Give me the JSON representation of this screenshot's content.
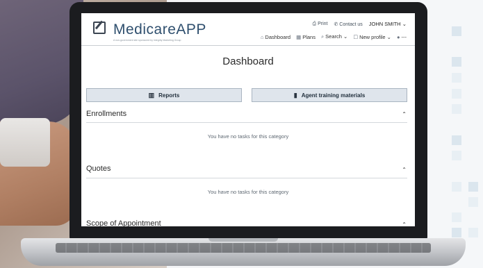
{
  "app": {
    "logo_text": "MedicareAPP",
    "tagline": "A non-government site sponsored by Integrity Marketing Group"
  },
  "header": {
    "utility": {
      "print_label": "Print",
      "contact_label": "Contact us",
      "user_name": "JOHN SMITH"
    },
    "nav": {
      "dashboard_label": "Dashboard",
      "plans_label": "Plans",
      "search_label": "Search",
      "new_profile_label": "New profile",
      "more_label": "---"
    }
  },
  "main": {
    "title": "Dashboard",
    "buttons": {
      "reports_label": "Reports",
      "training_label": "Agent training materials"
    },
    "sections": [
      {
        "title": "Enrollments",
        "empty_text": "You have no tasks for this category"
      },
      {
        "title": "Quotes",
        "empty_text": "You have no tasks for this category"
      },
      {
        "title": "Scope of Appointment"
      }
    ]
  },
  "icons": {
    "logo": "edit-square-icon",
    "print": "printer-icon",
    "contact": "phone-icon",
    "dashboard": "home-icon",
    "plans": "grid-icon",
    "search": "search-icon",
    "new_profile": "person-add-icon",
    "user_menu": "user-icon",
    "reports": "bar-chart-icon",
    "training": "book-icon",
    "collapse": "chevron-up-icon"
  },
  "colors": {
    "brand_text": "#2f4f6e",
    "button_bg": "#dfe5ec",
    "button_border": "#a9b4c0"
  }
}
